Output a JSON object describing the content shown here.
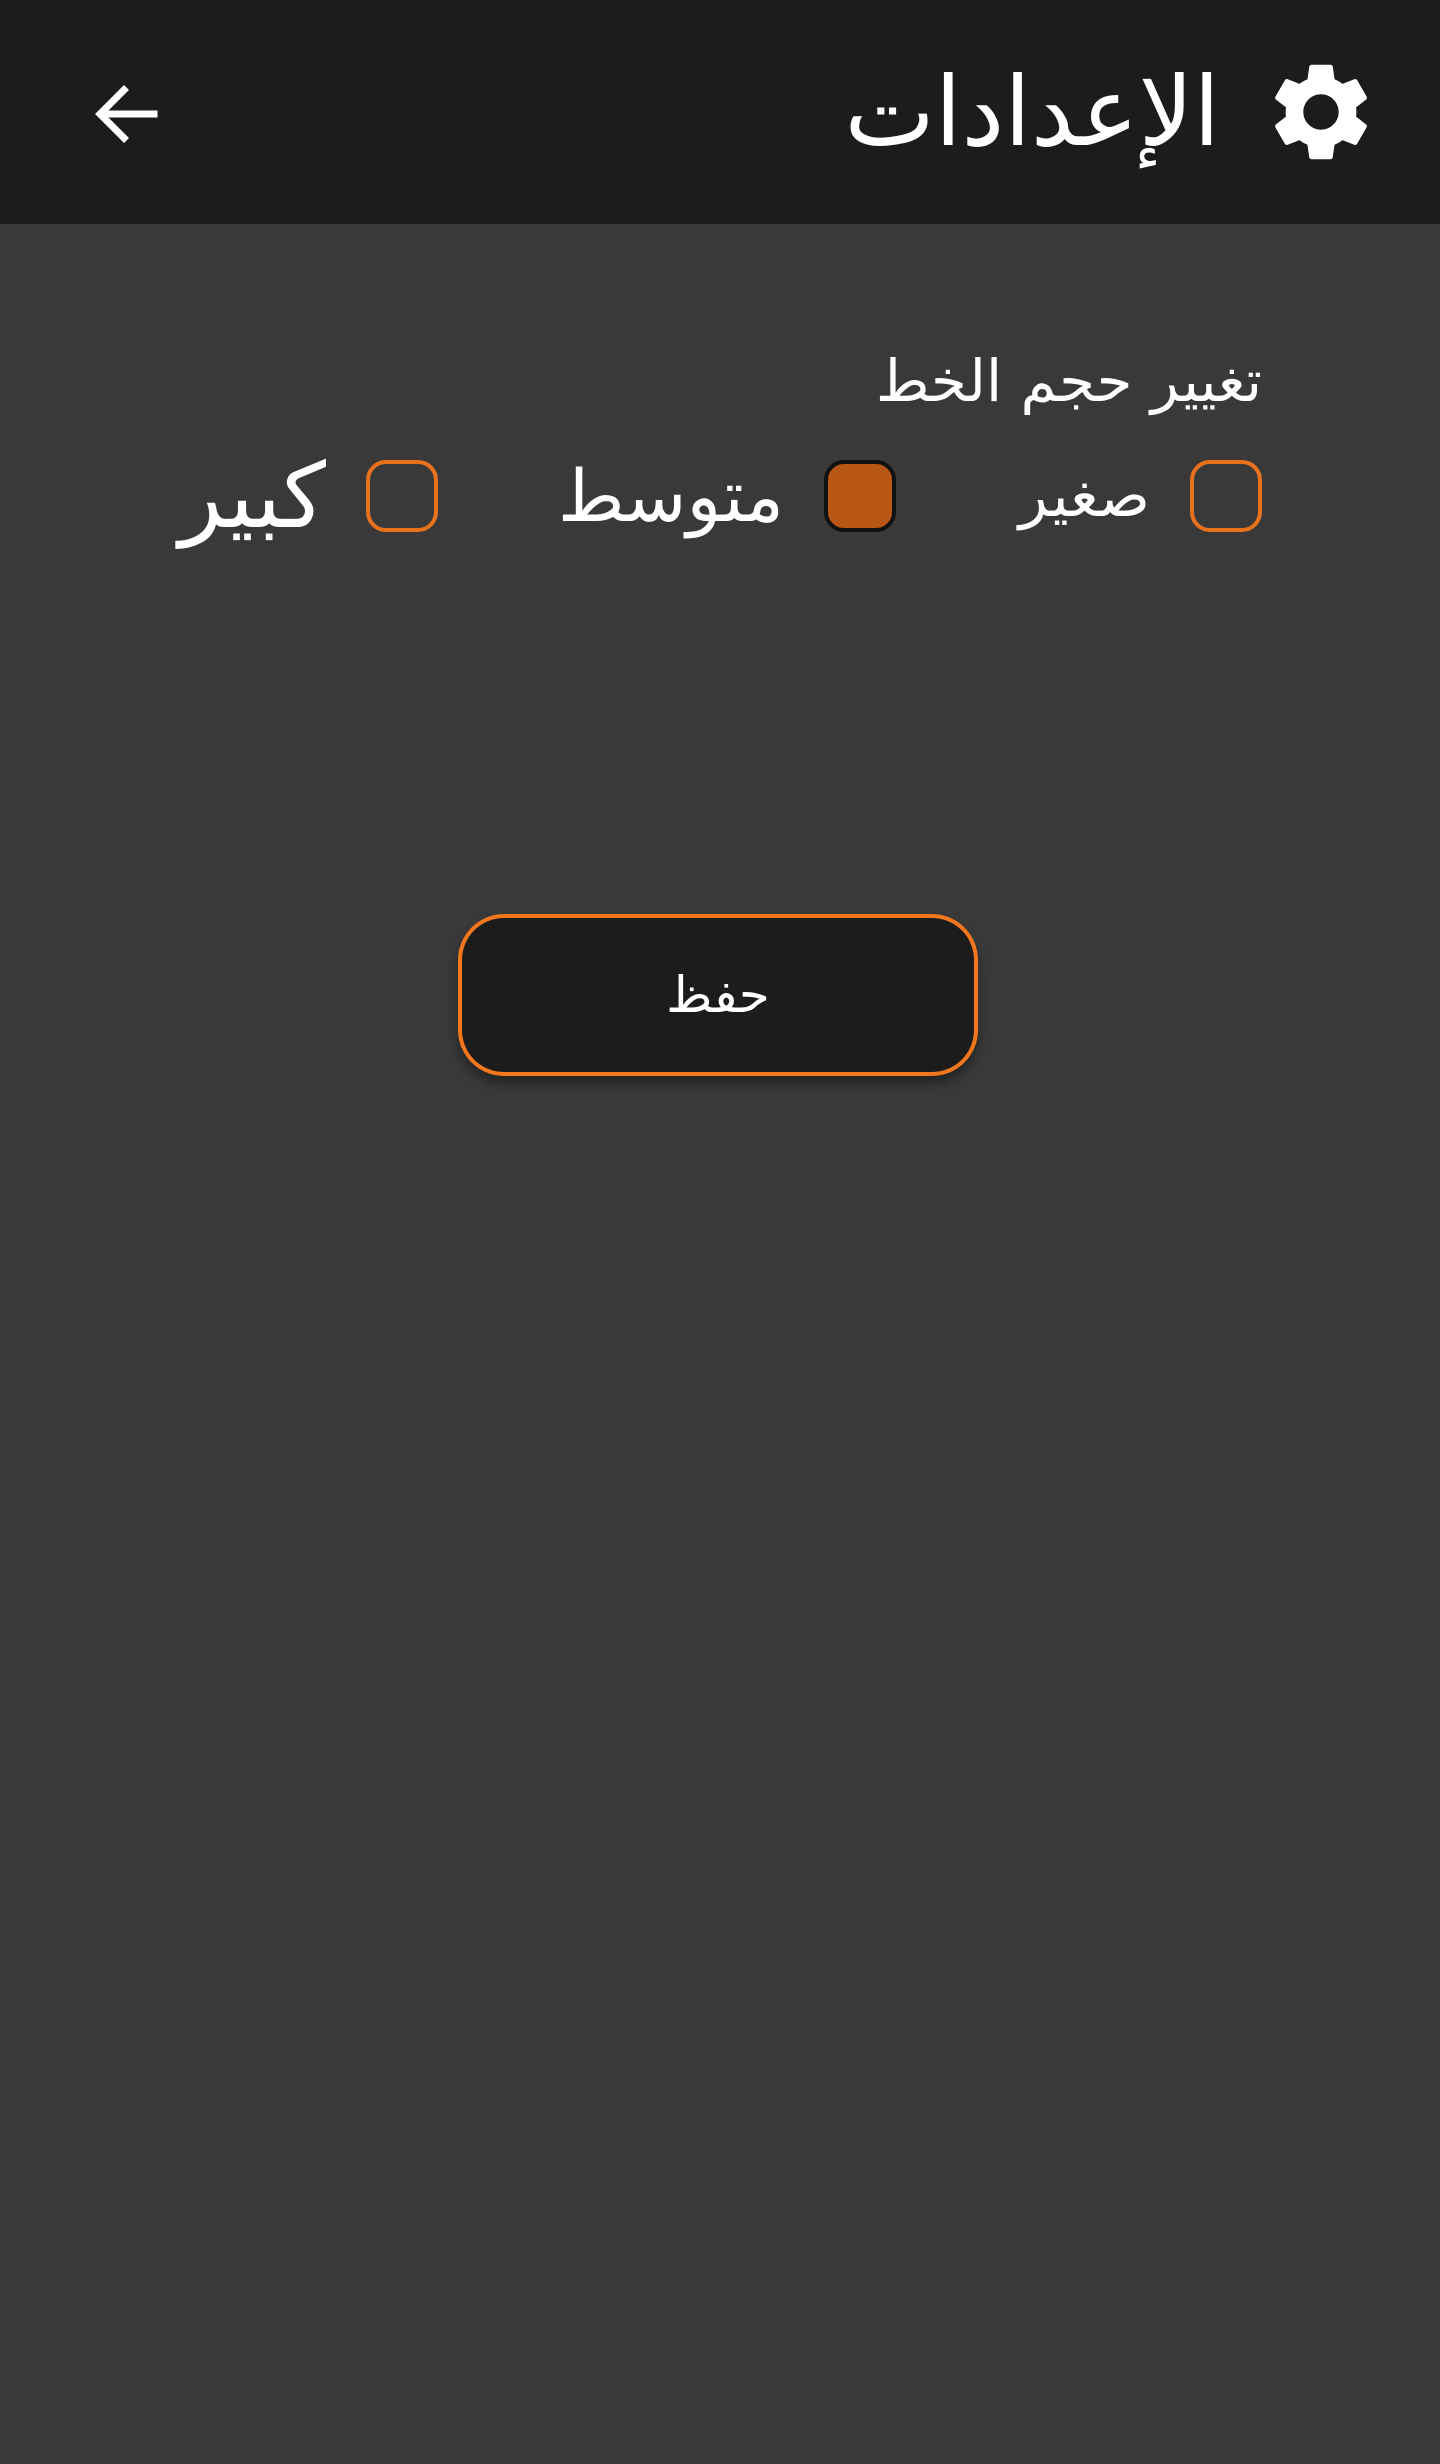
{
  "app_bar": {
    "title": "الإعدادات",
    "back_icon": "arrow-left-icon",
    "title_icon": "gear-icon",
    "background_color": "#1c1c1c"
  },
  "settings": {
    "font_size_label": "تغيير حجم الخط",
    "options": [
      {
        "label": "صغير",
        "checked": false
      },
      {
        "label": "متوسط",
        "checked": true
      },
      {
        "label": "كبير",
        "checked": false
      }
    ],
    "accent_color": "#e8721c",
    "checked_fill_color": "#b95714"
  },
  "actions": {
    "save_label": "حفظ"
  },
  "page": {
    "background_color": "#393939"
  }
}
